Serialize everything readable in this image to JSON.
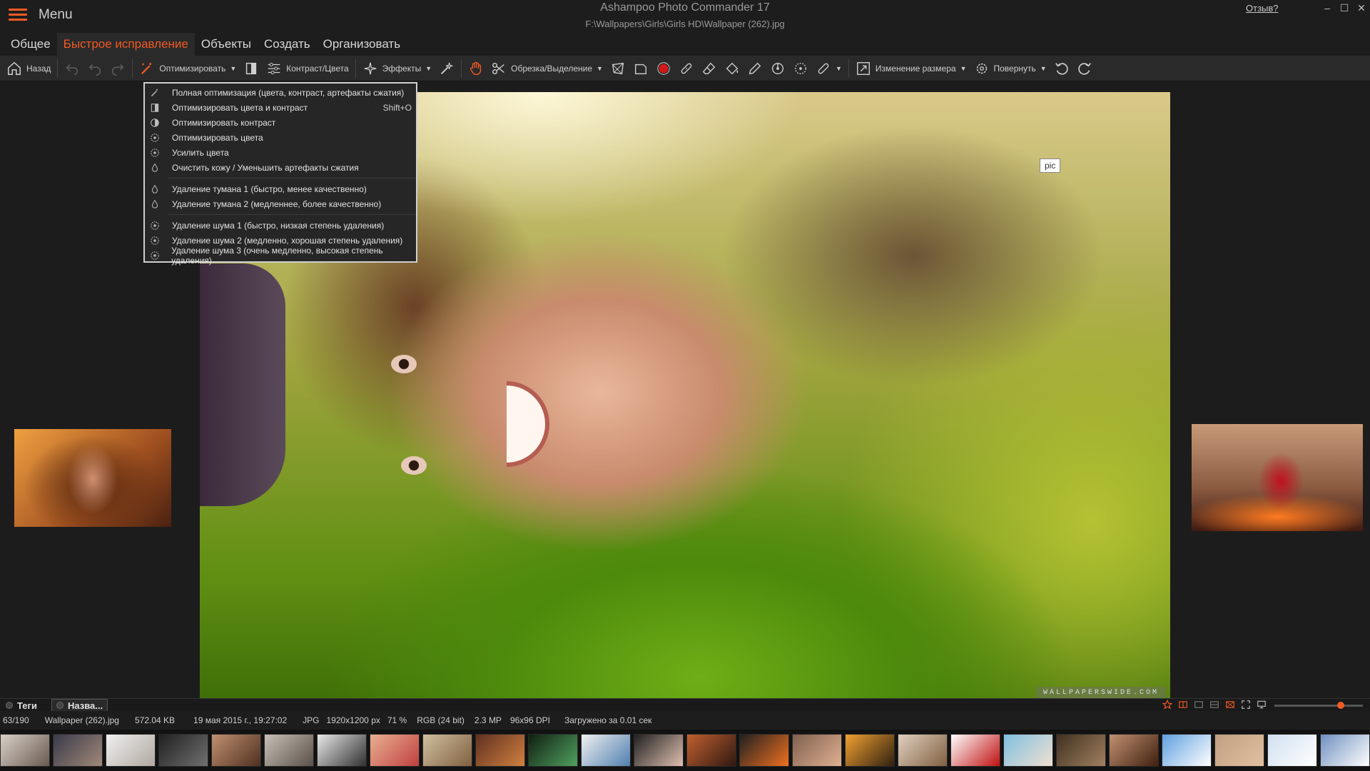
{
  "titlebar": {
    "menu_label": "Menu",
    "app_title": "Ashampoo Photo Commander 17",
    "file_path": "F:\\Wallpapers\\Girls\\Girls HD\\Wallpaper (262).jpg",
    "feedback": "Отзыв?",
    "minimize": "–",
    "maximize": "☐",
    "close": "✕"
  },
  "tabs": [
    {
      "label": "Общее"
    },
    {
      "label": "Быстрое исправление"
    },
    {
      "label": "Объекты"
    },
    {
      "label": "Создать"
    },
    {
      "label": "Организовать"
    }
  ],
  "toolbar": {
    "back": "Назад",
    "optimize": "Оптимизировать",
    "contrast_colors": "Контраст/Цвета",
    "effects": "Эффекты",
    "crop_select": "Обрезка/Выделение",
    "resize": "Изменение размера",
    "rotate": "Повернуть"
  },
  "dropdown": {
    "items": [
      {
        "label": "Полная оптимизация (цвета, контраст, артефакты сжатия)",
        "shortcut": ""
      },
      {
        "label": "Оптимизировать цвета и контраст",
        "shortcut": "Shift+O"
      },
      {
        "label": "Оптимизировать контраст",
        "shortcut": ""
      },
      {
        "label": "Оптимизировать цвета",
        "shortcut": ""
      },
      {
        "label": "Усилить цвета",
        "shortcut": ""
      },
      {
        "label": "Очистить кожу / Уменьшить артефакты сжатия",
        "shortcut": ""
      },
      {
        "label": "Удаление тумана 1 (быстро, менее качественно)",
        "shortcut": ""
      },
      {
        "label": "Удаление тумана 2 (медленнее, более качественно)",
        "shortcut": ""
      },
      {
        "label": "Удаление шума 1 (быстро, низкая степень удаления)",
        "shortcut": ""
      },
      {
        "label": "Удаление шума 2 (медленно, хорошая степень удаления)",
        "shortcut": ""
      },
      {
        "label": "Удаление шума 3 (очень медленно, высокая степень удаления)",
        "shortcut": ""
      }
    ]
  },
  "viewer": {
    "tooltip": "pic",
    "watermark": "WALLPAPERSWIDE.COM"
  },
  "bottom_tabs": {
    "tags": "Теги",
    "name": "Назва..."
  },
  "zoom": {
    "value_percent": 71
  },
  "status": {
    "index": "63/190",
    "filename": "Wallpaper (262).jpg",
    "size": "572.04 KB",
    "date": "19 мая 2015 г., 19:27:02",
    "format": "JPG",
    "dimensions": "1920x1200 px",
    "zoom": "71 %",
    "color": "RGB (24 bit)",
    "megapixels": "2.3 MP",
    "dpi": "96x96 DPI",
    "load_time": "Загружено за 0.01 сек"
  },
  "colors": {
    "accent": "#f05a24",
    "background": "#1b1b1b",
    "toolbar": "#2a2a2a"
  }
}
